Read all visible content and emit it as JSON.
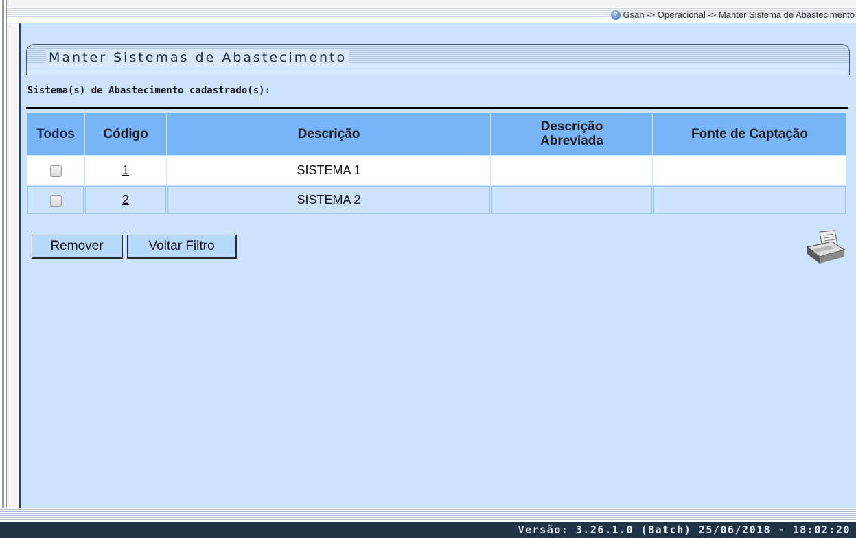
{
  "breadcrumb": "Gsan -> Operacional -> Manter Sistema de Abastecimento",
  "panel_title": "Manter Sistemas de Abastecimento",
  "list_label": "Sistema(s) de Abastecimento cadastrado(s):",
  "table": {
    "headers": {
      "todos": "Todos",
      "codigo": "Código",
      "descricao": "Descrição",
      "descricao_abreviada_1": "Descrição",
      "descricao_abreviada_2": "Abreviada",
      "fonte": "Fonte de Captação"
    },
    "rows": [
      {
        "codigo": "1",
        "descricao": "SISTEMA 1",
        "descricao_abreviada": "",
        "fonte": ""
      },
      {
        "codigo": "2",
        "descricao": "SISTEMA 2",
        "descricao_abreviada": "",
        "fonte": ""
      }
    ]
  },
  "buttons": {
    "remover": "Remover",
    "voltar_filtro": "Voltar Filtro"
  },
  "footer": "Versão: 3.26.1.0 (Batch) 25/06/2018 - 18:02:20",
  "icons": {
    "help": "help-icon",
    "printer": "printer-icon"
  }
}
